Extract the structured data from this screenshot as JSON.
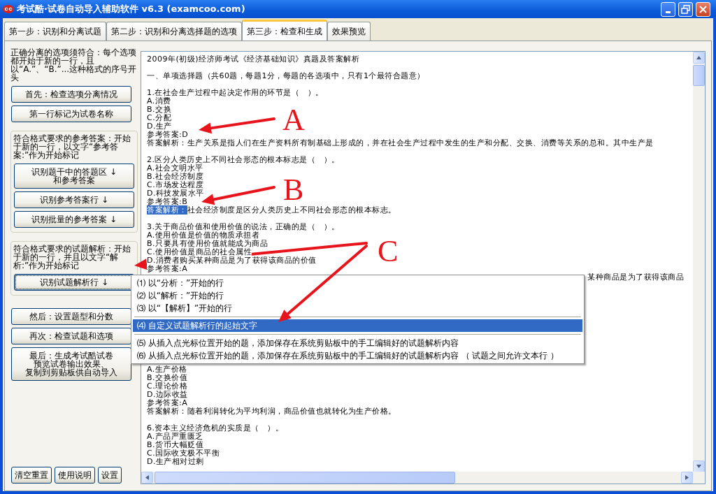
{
  "window": {
    "title": "考试酷·试卷自动导入辅助软件 v6.3 (examcoo.com)"
  },
  "tabs": [
    {
      "label": "第一步：识别和分离试题",
      "selected": false
    },
    {
      "label": "第二步：识别和分离选择题的选项",
      "selected": false
    },
    {
      "label": "第三步：检查和生成",
      "selected": true
    },
    {
      "label": "效果预览",
      "selected": false
    }
  ],
  "left_panel": {
    "sections": [
      {
        "boxed": false,
        "note": "正确分离的选项须符合：每个选项都开始于新的一行，且以“A.”、“B.”...这种格式的序号开头",
        "buttons": [
          {
            "label": "首先：检查选项分离情况",
            "focused": false
          },
          {
            "label": "第一行标记为试卷名称",
            "focused": false
          }
        ]
      },
      {
        "boxed": true,
        "note": "符合格式要求的参考答案：开始于新的一行，以文字“参考答案:”作为开始标记",
        "buttons": [
          {
            "label": [
              "识别题干中的答题区 ↓",
              "和参考答案"
            ],
            "focused": false
          },
          {
            "label": "识别参考答案行 ↓",
            "focused": false
          },
          {
            "label": "识别批量的参考答案 ↓",
            "focused": false
          }
        ]
      },
      {
        "boxed": true,
        "note": "符合格式要求的试题解析：开始于新的一行，并且以文字“解析:”作为开始标记",
        "buttons": [
          {
            "label": "识别试题解析行 ↓",
            "focused": true
          }
        ]
      },
      {
        "boxed": false,
        "buttons": [
          {
            "label": "然后：设置题型和分数",
            "focused": false
          },
          {
            "label": "再次：检查试题和选项",
            "focused": false
          },
          {
            "label": [
              "最后：生成考试酷试卷",
              "预览试卷输出效果、",
              "复制到剪贴板供自动导入"
            ],
            "focused": false
          }
        ]
      }
    ],
    "footer_buttons": [
      "清空重置",
      "使用说明",
      "设置"
    ]
  },
  "editor": {
    "lines": [
      {
        "kind": "text",
        "text": "2009年(初级)经济师考试《经济基础知识》真题及答案解析"
      },
      {
        "kind": "blank"
      },
      {
        "kind": "text",
        "text": "一、单项选择题（共60题，每题1分，每题的各选项中，只有1个最符合题意）"
      },
      {
        "kind": "blank"
      },
      {
        "kind": "text",
        "text": "1.在社会生产过程中起决定作用的环节是（　）。"
      },
      {
        "kind": "text",
        "text": "A.消费"
      },
      {
        "kind": "text",
        "text": "B.交换"
      },
      {
        "kind": "text",
        "text": "C.分配"
      },
      {
        "kind": "text",
        "text": "D.生产"
      },
      {
        "kind": "text",
        "text": "参考答案:D"
      },
      {
        "kind": "text",
        "text": "答案解析：生产关系是指人们在生产资料所有制基础上形成的，并在社会生产过程中发生的生产和分配、交换、消费等关系的总和。其中生产是"
      },
      {
        "kind": "blank"
      },
      {
        "kind": "text",
        "text": "2.区分人类历史上不同社会形态的根本标志是（　）。"
      },
      {
        "kind": "text",
        "text": "A.社会文明水平"
      },
      {
        "kind": "text",
        "text": "B.社会经济制度"
      },
      {
        "kind": "text",
        "text": "C.市场发达程度"
      },
      {
        "kind": "text",
        "text": "D.科技发展水平"
      },
      {
        "kind": "text",
        "text": "参考答案:B"
      },
      {
        "kind": "selection",
        "selected_text": "答案解析：",
        "text": "社会经济制度是区分人类历史上不同社会形态的根本标志。"
      },
      {
        "kind": "blank"
      },
      {
        "kind": "text",
        "text": "3.关于商品价值和使用价值的说法，正确的是（　）。"
      },
      {
        "kind": "text",
        "text": "A.使用价值是价值的物质承担者"
      },
      {
        "kind": "text",
        "text": "B.只要具有使用价值就能成为商品"
      },
      {
        "kind": "text",
        "text": "C.使用价值是商品的社会属性"
      },
      {
        "kind": "text",
        "text": "D.消费者购买某种商品是为了获得该商品的价值"
      },
      {
        "kind": "text",
        "text": "参考答案:A"
      },
      {
        "kind": "tail",
        "text": "某种商品是为了获得该商品"
      },
      {
        "kind": "blank"
      },
      {
        "kind": "blank"
      },
      {
        "kind": "blank"
      },
      {
        "kind": "blank"
      },
      {
        "kind": "blank"
      },
      {
        "kind": "blank"
      },
      {
        "kind": "blank"
      },
      {
        "kind": "blank"
      },
      {
        "kind": "blank"
      },
      {
        "kind": "blank"
      },
      {
        "kind": "text",
        "text": "A.生产价格"
      },
      {
        "kind": "text",
        "text": "B.交换价值"
      },
      {
        "kind": "text",
        "text": "C.理论价格"
      },
      {
        "kind": "text",
        "text": "D.边际收益"
      },
      {
        "kind": "text",
        "text": "参考答案:A"
      },
      {
        "kind": "text",
        "text": "答案解析：随着利润转化为平均利润，商品价值也就转化为生产价格。"
      },
      {
        "kind": "blank"
      },
      {
        "kind": "text",
        "text": "6.资本主义经济危机的实质是（　）。"
      },
      {
        "kind": "text",
        "text": "A.产品严重匮乏"
      },
      {
        "kind": "text",
        "text": "B.货币大幅贬值"
      },
      {
        "kind": "text",
        "text": "C.国际收支极不平衡"
      },
      {
        "kind": "text",
        "text": "D.生产相对过剩"
      }
    ]
  },
  "context_menu": {
    "items": [
      {
        "number": "⑴",
        "label": "以“分析：”开始的行",
        "selected": false,
        "separator_before": false
      },
      {
        "number": "⑵",
        "label": "以“解析：”开始的行",
        "selected": false,
        "separator_before": false
      },
      {
        "number": "⑶",
        "label": "以“【解析】”开始的行",
        "selected": false,
        "separator_before": false
      },
      {
        "number": "⑷",
        "label": "自定义试题解析行的起始文字",
        "selected": true,
        "separator_before": true
      },
      {
        "number": "⑸",
        "label": "从插入点光标位置开始的题，添加保存在系统剪贴板中的手工编辑好的试题解析内容",
        "selected": false,
        "separator_before": true
      },
      {
        "number": "⑹",
        "label": "从插入点光标位置开始的题，添加保存在系统剪贴板中的手工编辑好的试题解析内容 （ 试题之间允许文本行 ）",
        "selected": false,
        "separator_before": false
      }
    ]
  },
  "annotations": [
    {
      "letter": "A"
    },
    {
      "letter": "B"
    },
    {
      "letter": "C"
    }
  ]
}
